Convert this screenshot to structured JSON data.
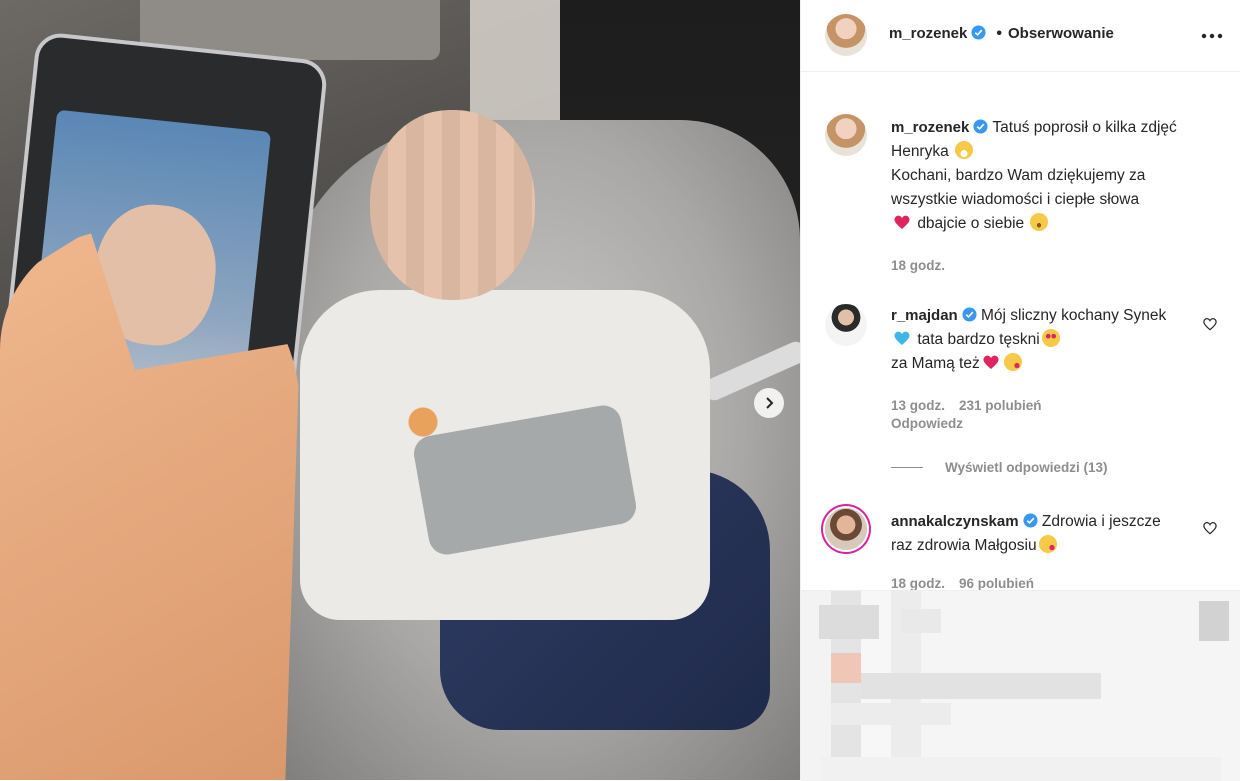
{
  "post": {
    "author": "m_rozenek",
    "follow_label": "Obserwowanie",
    "dot": "•"
  },
  "caption": {
    "user": "m_rozenek",
    "line1": "Tatuś poprosił o kilka zdjęć Henryka",
    "line2": "Kochani, bardzo Wam dziękujemy za wszystkie wiadomości i ciepłe słowa",
    "line3": "dbajcie o siebie",
    "time": "18 godz."
  },
  "comments": [
    {
      "user": "r_majdan",
      "part1": "Mój sliczny kochany Synek",
      "part2": "tata bardzo tęskni",
      "part3": "za Mamą też",
      "time": "13 godz.",
      "likes": "231 polubień",
      "reply": "Odpowiedz",
      "view_replies": "Wyświetl odpowiedzi (13)"
    },
    {
      "user": "annakalczynskam",
      "text": "Zdrowia i jeszcze raz zdrowia Małgosiu",
      "time": "18 godz.",
      "likes": "96 polubień"
    }
  ],
  "icons": {
    "verified": "verified-badge-icon",
    "more": "more-options-icon",
    "heart": "heart-outline-icon",
    "next": "chevron-right-icon"
  },
  "colors": {
    "verified": "#3897f0",
    "text": "#262626",
    "muted": "#8e8e8e",
    "heart": "#e0245e"
  }
}
